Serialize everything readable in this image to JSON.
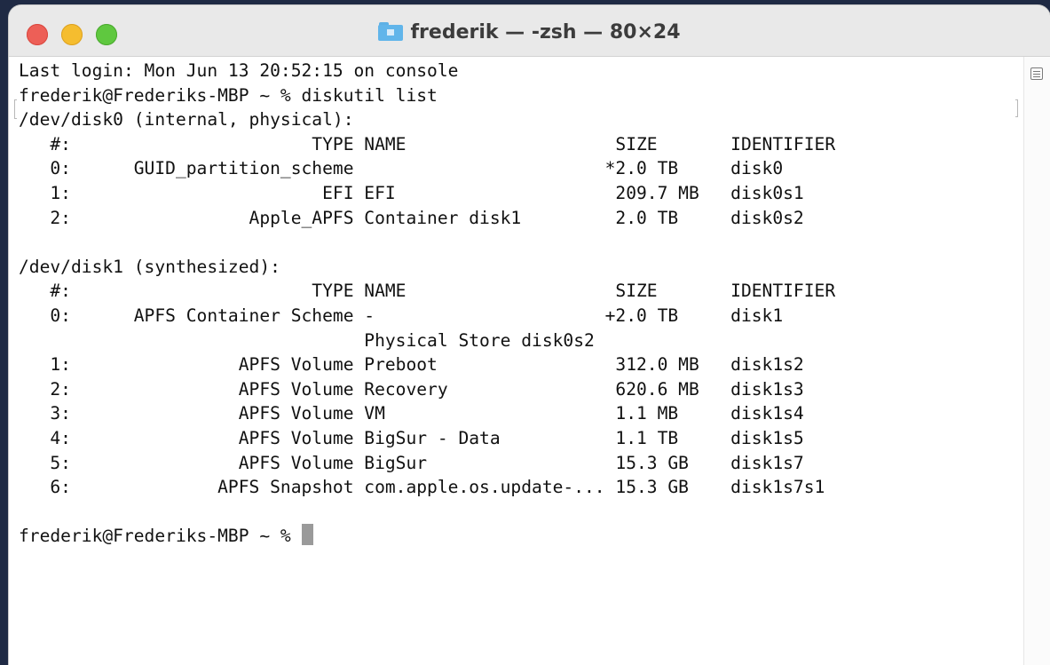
{
  "window": {
    "title": "frederik — -zsh — 80×24",
    "title_icon": "home-folder-icon"
  },
  "terminal": {
    "lines": [
      "Last login: Mon Jun 13 20:52:15 on console",
      "frederik@Frederiks-MBP ~ % diskutil list",
      "/dev/disk0 (internal, physical):",
      "   #:                       TYPE NAME                    SIZE       IDENTIFIER",
      "   0:      GUID_partition_scheme                        *2.0 TB     disk0",
      "   1:                        EFI EFI                     209.7 MB   disk0s1",
      "   2:                 Apple_APFS Container disk1         2.0 TB     disk0s2",
      "",
      "/dev/disk1 (synthesized):",
      "   #:                       TYPE NAME                    SIZE       IDENTIFIER",
      "   0:      APFS Container Scheme -                      +2.0 TB     disk1",
      "                                 Physical Store disk0s2",
      "   1:                APFS Volume Preboot                 312.0 MB   disk1s2",
      "   2:                APFS Volume Recovery                620.6 MB   disk1s3",
      "   3:                APFS Volume VM                      1.1 MB     disk1s4",
      "   4:                APFS Volume BigSur - Data           1.1 TB     disk1s5",
      "   5:                APFS Volume BigSur                  15.3 GB    disk1s7",
      "   6:              APFS Snapshot com.apple.os.update-... 15.3 GB    disk1s7s1",
      "",
      "frederik@Frederiks-MBP ~ % "
    ]
  },
  "colors": {
    "close": "#ed5f57",
    "minimize": "#f5bd2f",
    "zoom": "#5fc83f",
    "text": "#111111",
    "cursor": "#9a9a9a"
  }
}
